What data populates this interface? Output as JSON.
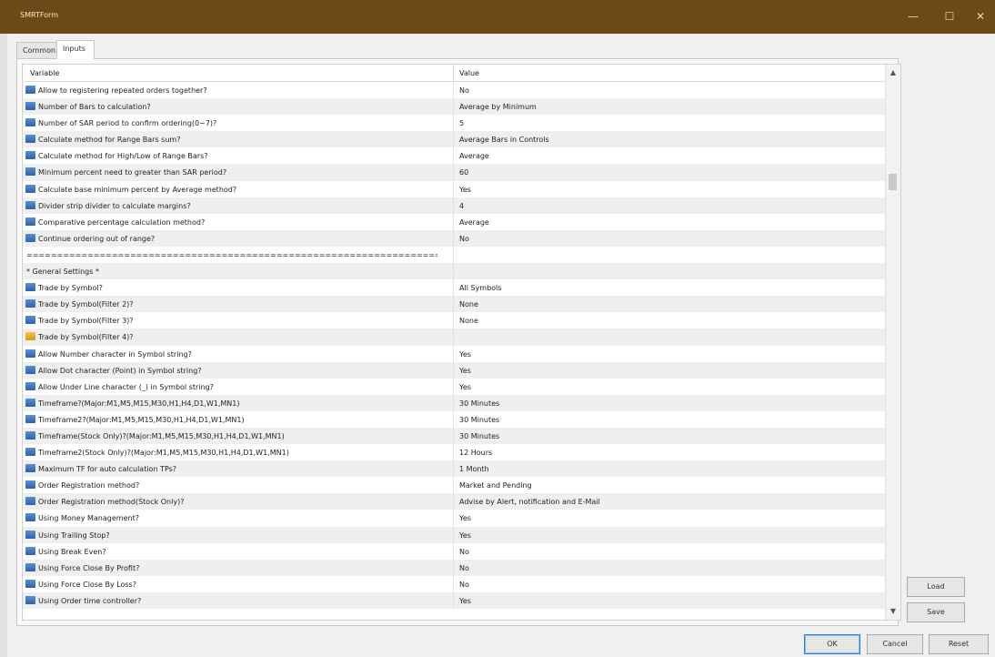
{
  "window": {
    "title": "SMRTForm",
    "controls": [
      "—",
      "☐",
      "✕"
    ]
  },
  "tabs": [
    "Common",
    "Inputs"
  ],
  "table": {
    "columns": [
      "Variable",
      "Value"
    ],
    "rows": [
      {
        "icon": "db",
        "var": "Allow to registering repeated orders together?",
        "val": "No"
      },
      {
        "icon": "db",
        "var": "Number of Bars to calculation?",
        "val": "Average by Minimum"
      },
      {
        "icon": "db",
        "var": "Number of SAR period to confirm ordering(0~7)?",
        "val": "5"
      },
      {
        "icon": "db",
        "var": "Calculate method for Range Bars sum?",
        "val": "Average Bars in Controls"
      },
      {
        "icon": "db",
        "var": "Calculate method for High/Low of Range Bars?",
        "val": "Average"
      },
      {
        "icon": "db",
        "var": "Minimum percent need to greater than SAR period?",
        "val": "60"
      },
      {
        "icon": "db",
        "var": "Calculate base minimum percent by Average method?",
        "val": "Yes"
      },
      {
        "icon": "db",
        "var": "Divider strip divider to calculate margins?",
        "val": "4"
      },
      {
        "icon": "db",
        "var": "Comparative percentage calculation method?",
        "val": "Average"
      },
      {
        "icon": "db",
        "var": "Continue ordering out of range?",
        "val": "No"
      },
      {
        "icon": "none",
        "var": "============================================================================",
        "val": ""
      },
      {
        "icon": "none",
        "var": "* General Settings *",
        "val": ""
      },
      {
        "icon": "db",
        "var": "Trade by Symbol?",
        "val": "All Symbols"
      },
      {
        "icon": "db",
        "var": "Trade by Symbol(Filter 2)?",
        "val": "None"
      },
      {
        "icon": "db",
        "var": "Trade by Symbol(Filter 3)?",
        "val": "None"
      },
      {
        "icon": "ab",
        "var": "Trade by Symbol(Filter 4)?",
        "val": ""
      },
      {
        "icon": "db",
        "var": "Allow Number character in Symbol string?",
        "val": "Yes"
      },
      {
        "icon": "db",
        "var": "Allow Dot character (Point) in Symbol string?",
        "val": "Yes"
      },
      {
        "icon": "db",
        "var": "Allow Under Line character (_) in Symbol string?",
        "val": "Yes"
      },
      {
        "icon": "db",
        "var": "Timeframe?(Major:M1,M5,M15,M30,H1,H4,D1,W1,MN1)",
        "val": "30 Minutes"
      },
      {
        "icon": "db",
        "var": "Timeframe2?(Major:M1,M5,M15,M30,H1,H4,D1,W1,MN1)",
        "val": "30 Minutes"
      },
      {
        "icon": "db",
        "var": "Timeframe(Stock Only)?(Major:M1,M5,M15,M30,H1,H4,D1,W1,MN1)",
        "val": "30 Minutes"
      },
      {
        "icon": "db",
        "var": "Timeframe2(Stock Only)?(Major:M1,M5,M15,M30,H1,H4,D1,W1,MN1)",
        "val": "12 Hours"
      },
      {
        "icon": "db",
        "var": "Maximum TF for auto calculation TPs?",
        "val": "1 Month"
      },
      {
        "icon": "db",
        "var": "Order Registration method?",
        "val": "Market and Pending"
      },
      {
        "icon": "db",
        "var": "Order Registration method(Stock Only)?",
        "val": "Advise by Alert, notification and E-Mail"
      },
      {
        "icon": "db",
        "var": "Using Money Management?",
        "val": "Yes"
      },
      {
        "icon": "db",
        "var": "Using Trailing Stop?",
        "val": "Yes"
      },
      {
        "icon": "db",
        "var": "Using Break Even?",
        "val": "No"
      },
      {
        "icon": "db",
        "var": "Using Force Close By Profit?",
        "val": "No"
      },
      {
        "icon": "db",
        "var": "Using Force Close By Loss?",
        "val": "No"
      },
      {
        "icon": "db",
        "var": "Using Order time controller?",
        "val": "Yes"
      }
    ]
  },
  "side_buttons": {
    "load": "Load",
    "save": "Save"
  },
  "bottom_buttons": {
    "ok": "OK",
    "cancel": "Cancel",
    "reset": "Reset"
  },
  "scroll": {
    "up": "▲",
    "down": "▼"
  }
}
